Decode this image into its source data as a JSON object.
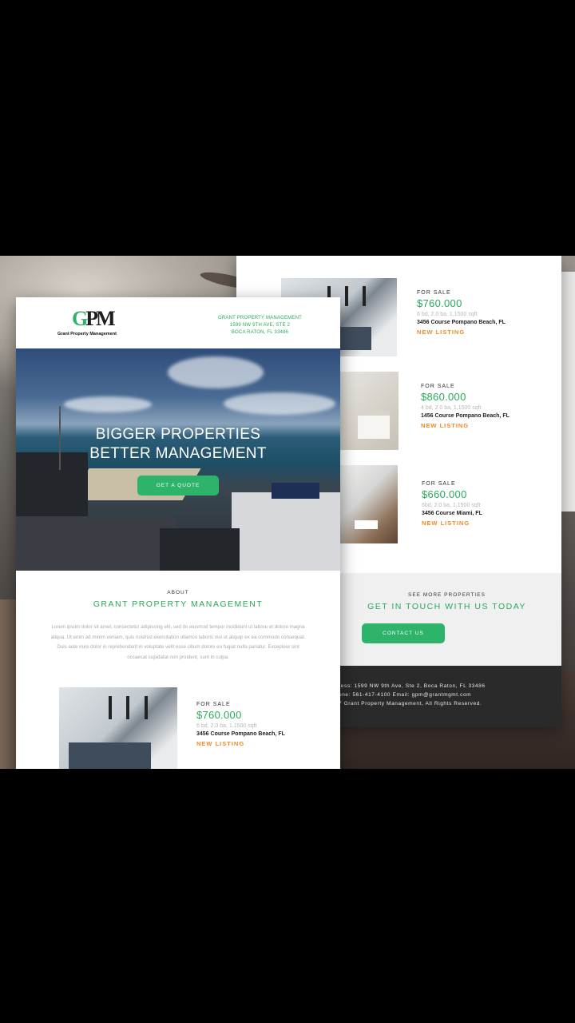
{
  "listing_template": {
    "for_sale": "FOR SALE",
    "new_listing": "NEW LISTING"
  },
  "back_listings": [
    {
      "price": "$760.000",
      "meta": "6 bd, 2.0 ba, 1,1500 sqft",
      "address": "3456 Course Pompano Beach, FL"
    },
    {
      "price": "$860.000",
      "meta": "4 bd, 2.0 ba, 1,1500 sqft",
      "address": "1456 Course Pompano Beach, FL"
    },
    {
      "price": "$660.000",
      "meta": "6bd, 2.0 ba, 1,1500 sqft",
      "address": "3456 Course Miami, FL"
    }
  ],
  "see_more": {
    "small": "SEE MORE PROPERTIES",
    "big": "GET IN TOUCH WITH US TODAY",
    "button": "CONTACT US"
  },
  "footer": {
    "address": "ress: 1599 NW 9th Ave, Ste 2, Boca Raton, FL 33486",
    "contact": "one: 561-417-4100   Email: gpm@grantmgmt.com",
    "copyright": "7 Grant Property Management, All Rights Reserved."
  },
  "header": {
    "logo_mark": "GPM",
    "logo_sub": "Grant Property Management",
    "address_lines": [
      "GRANT PROPERTY MANAGEMENT",
      "1599 NW 9TH AVE, STE 2",
      "BOCA RATON, FL 33486"
    ]
  },
  "hero": {
    "title_line1": "BIGGER PROPERTIES",
    "title_line2": "BETTER MANAGEMENT",
    "button": "GET A QUOTE"
  },
  "about": {
    "small": "ABOUT",
    "big": "GRANT PROPERTY MANAGEMENT",
    "body": "Lorem ipsum dolor sit amet, consectetur adipiscing elit, sed do eiusmod tempor incididunt ut labore et dolore magna aliqua. Ut enim ad minim veniam, quis nostrud exercitation ullamco laboris nisi ut aliquip ex ea commodo consequat. Duis aute irure dolor in reprehenderit in voluptate velit esse cillum dolore eu fugiat nulla pariatur. Excepteur sint occaecat cupidatat non proident, sunt in culpa."
  },
  "front_listing": {
    "price": "$760.000",
    "meta": "6 bd, 2.0 ba, 1,1500 sqft",
    "address": "3456 Course Pompano Beach, FL"
  },
  "colors": {
    "accent_green": "#2eb46a",
    "accent_orange": "#f28a22",
    "footer_dark": "#2a2a2a"
  }
}
